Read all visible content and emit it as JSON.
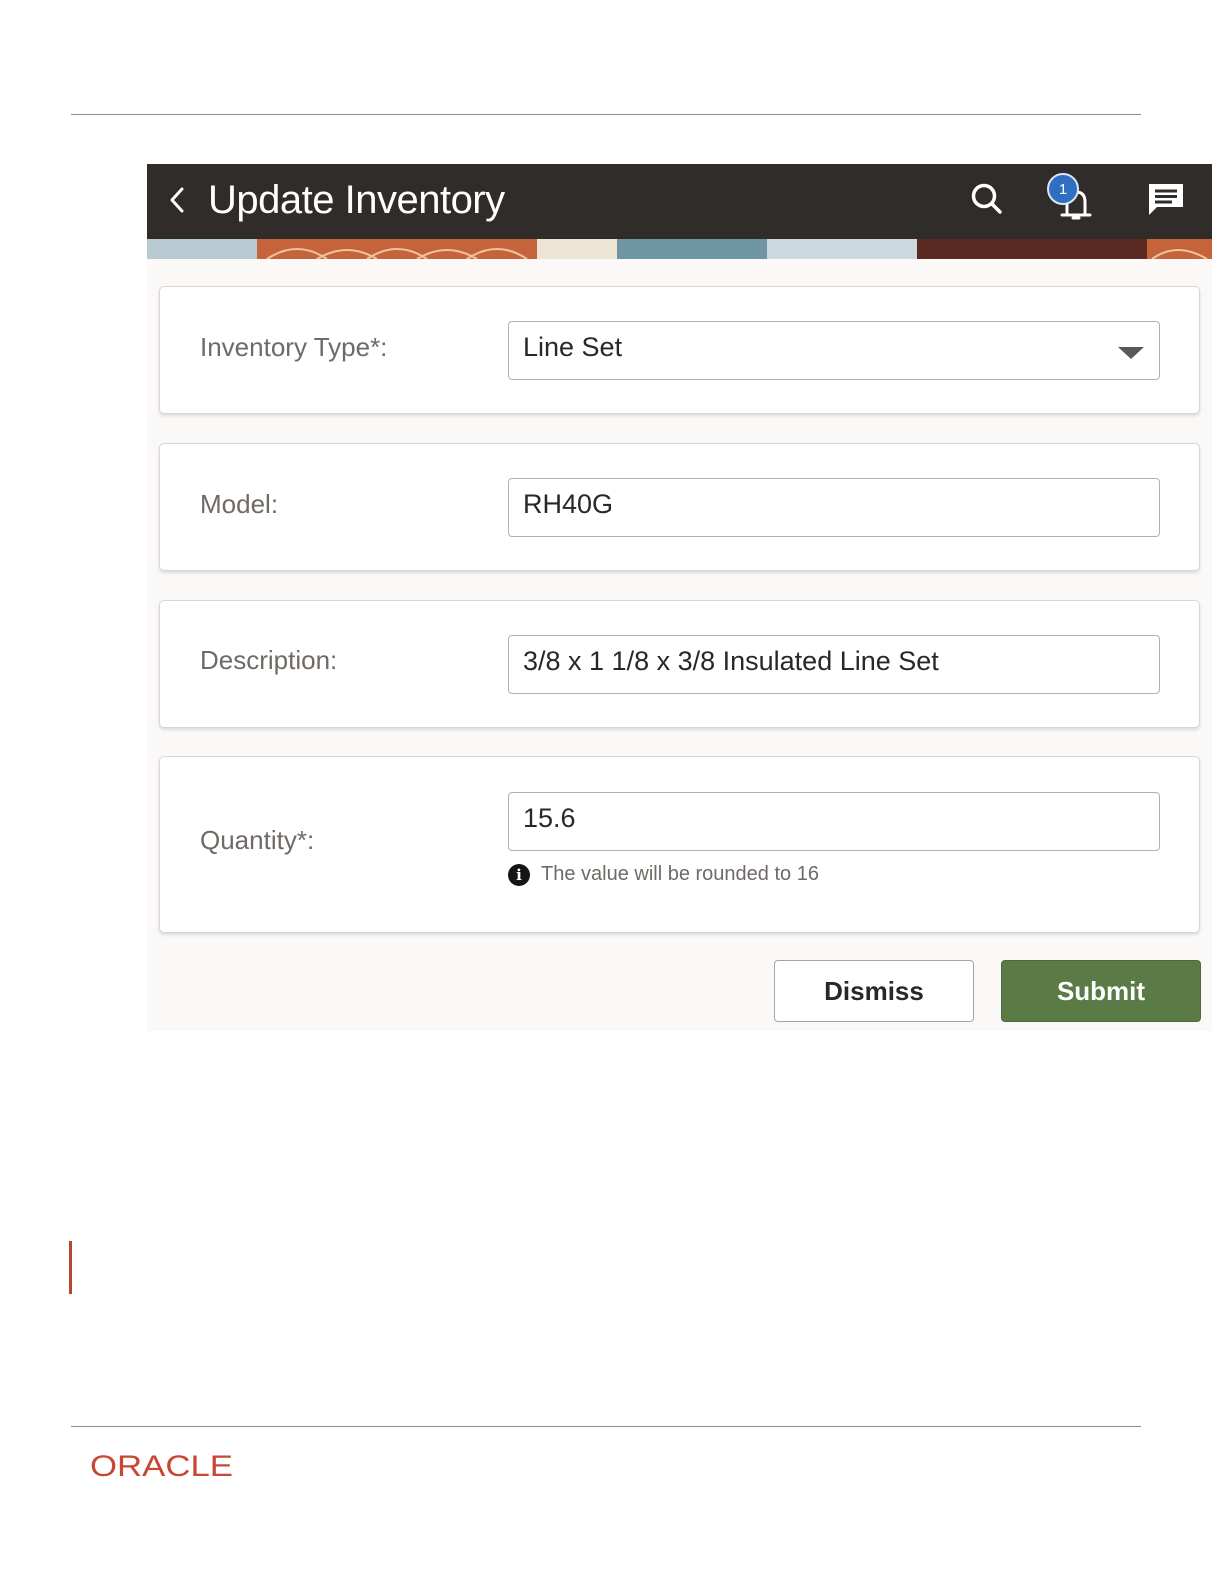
{
  "header": {
    "title": "Update Inventory",
    "notification_count": "1",
    "icons": [
      "back-chevron-icon",
      "search-icon",
      "bell-icon",
      "chat-icon"
    ]
  },
  "form": {
    "inventory_type": {
      "label": "Inventory Type*:",
      "value": "Line Set"
    },
    "model": {
      "label": "Model:",
      "value": "RH40G"
    },
    "description": {
      "label": "Description:",
      "value": "3/8 x 1 1/8 x 3/8 Insulated Line Set"
    },
    "quantity": {
      "label": "Quantity*:",
      "value": "15.6",
      "hint": "The value will be rounded to 16",
      "hint_icon": "i"
    }
  },
  "actions": {
    "dismiss": "Dismiss",
    "submit": "Submit"
  },
  "footer": {
    "logo_text": "ORACLE"
  },
  "colors": {
    "header": "#302c2a",
    "submit": "#5a7a46",
    "brand": "#c74634",
    "change_bar": "#b5472a"
  }
}
